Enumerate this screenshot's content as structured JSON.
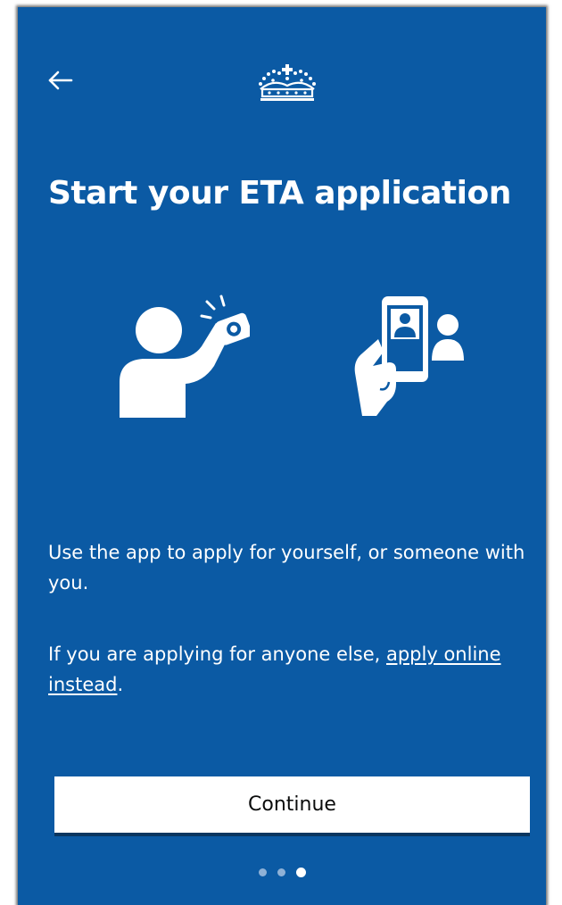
{
  "header": {
    "back_icon": "arrow-left-icon",
    "logo_icon": "royal-crown-icon"
  },
  "page": {
    "title": "Start your ETA application",
    "illustrations": [
      "selfie-camera-icon",
      "phone-photo-person-icon"
    ],
    "paragraph1": "Use the app to apply for yourself, or someone with you.",
    "paragraph2_text": "If you are applying for anyone else, ",
    "paragraph2_link": "apply online instead",
    "paragraph2_suffix": "."
  },
  "actions": {
    "continue_label": "Continue"
  },
  "pager": {
    "total": 3,
    "current": 3
  },
  "colors": {
    "background": "#0b5aa4",
    "text": "#ffffff",
    "button_bg": "#ffffff",
    "button_text": "#0b0c0c"
  }
}
